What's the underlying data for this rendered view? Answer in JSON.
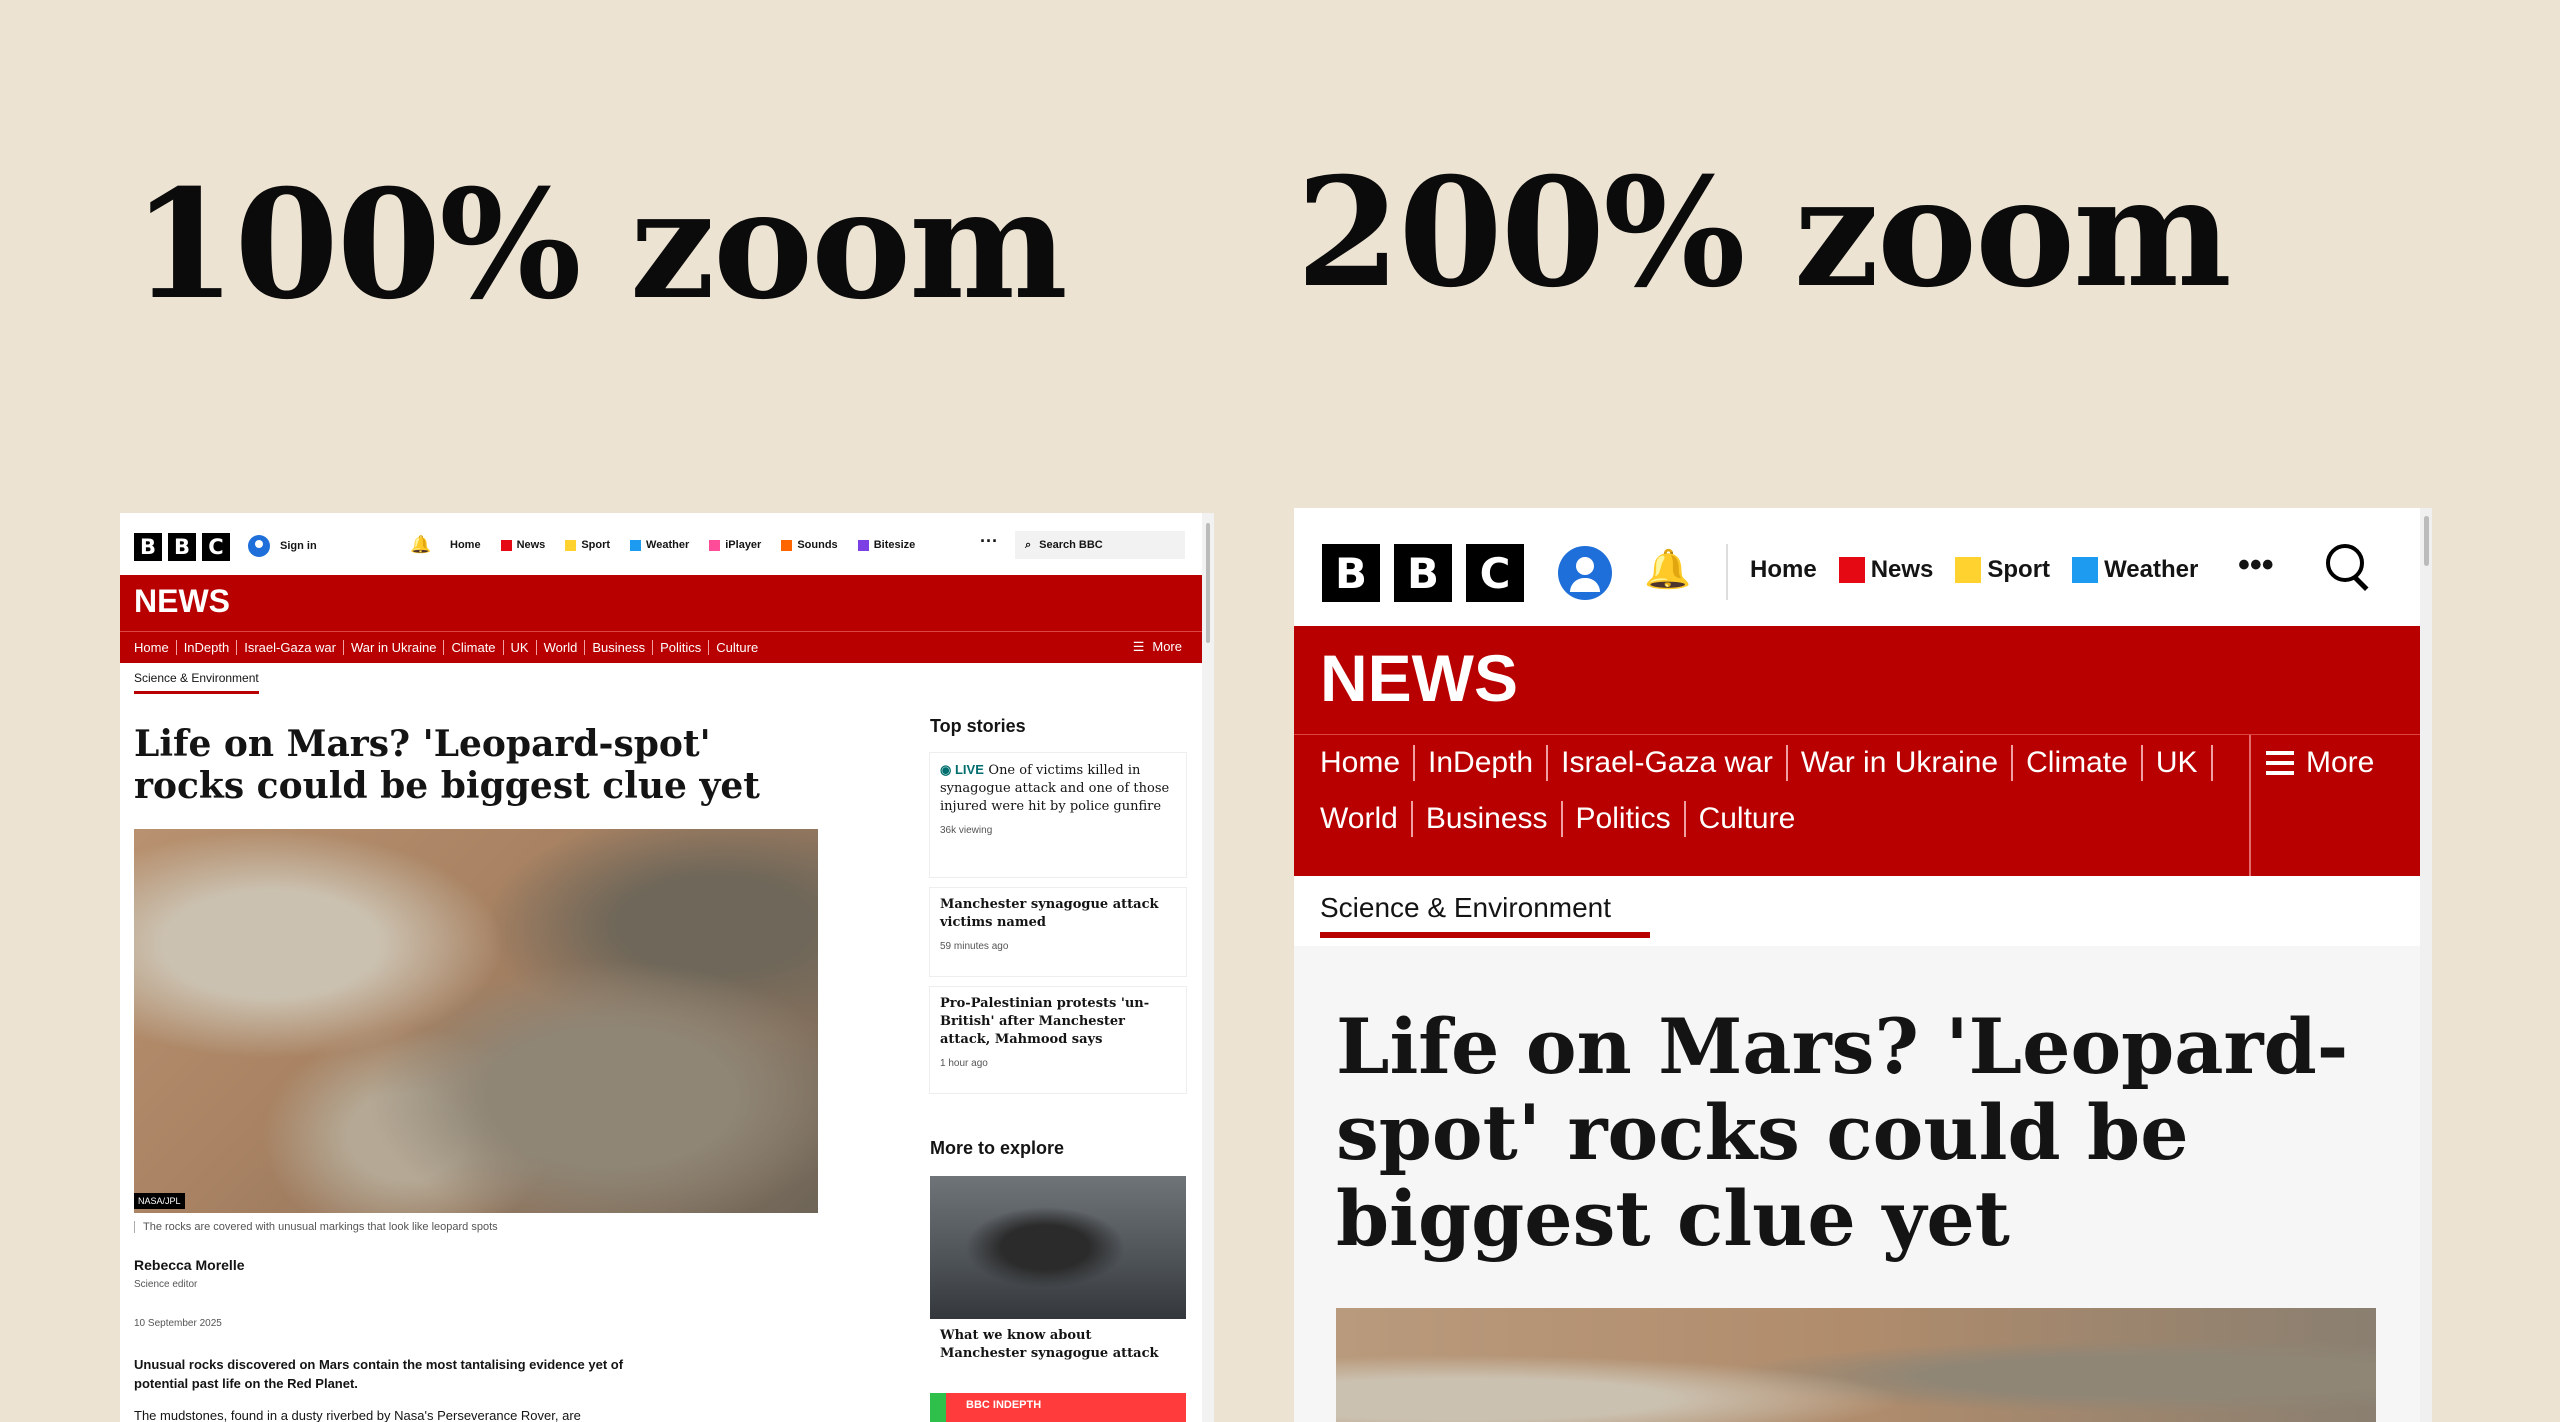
{
  "headings": {
    "left": "100% zoom",
    "right": "200% zoom"
  },
  "colors": {
    "background": "#ede3d3",
    "bbc_red": "#b80000",
    "news_icon": "#e50914",
    "sport_icon": "#ffd230",
    "weather_icon": "#1d9bf0",
    "iplayer_icon": "#ff4c98",
    "sounds_icon": "#ff6600",
    "bitesize_icon": "#7b3fe4"
  },
  "small": {
    "logo": [
      "B",
      "B",
      "C"
    ],
    "signin": "Sign in",
    "nav": [
      "Home",
      "News",
      "Sport",
      "Weather",
      "iPlayer",
      "Sounds",
      "Bitesize"
    ],
    "search_placeholder": "Search BBC",
    "news_label": "NEWS",
    "menu": [
      "Home",
      "InDepth",
      "Israel-Gaza war",
      "War in Ukraine",
      "Climate",
      "UK",
      "World",
      "Business",
      "Politics",
      "Culture"
    ],
    "menu_more": "More",
    "section": "Science & Environment",
    "title": "Life on Mars? 'Leopard-spot' rocks could be biggest clue yet",
    "image_credit": "NASA/JPL",
    "caption": "The rocks are covered with unusual markings that look like leopard spots",
    "author": "Rebecca Morelle",
    "role": "Science editor",
    "date": "10 September 2025",
    "lead": "Unusual rocks discovered on Mars contain the most tantalising evidence yet of potential past life on the Red Planet.",
    "body": "The mudstones, found in a dusty riverbed by Nasa's Perseverance Rover, are",
    "top_stories_heading": "Top stories",
    "top_stories": [
      {
        "live": "LIVE",
        "text": "One of victims killed in synagogue attack and one of those injured were hit by police gunfire",
        "meta": "36k viewing"
      },
      {
        "text": "Manchester synagogue attack victims named",
        "meta": "59 minutes ago"
      },
      {
        "text": "Pro-Palestinian protests 'un-British' after Manchester attack, Mahmood says",
        "meta": "1 hour ago"
      }
    ],
    "explore_heading": "More to explore",
    "explore_caption": "What we know about Manchester synagogue attack",
    "indepth_badge": "BBC INDEPTH"
  },
  "large": {
    "logo": [
      "B",
      "B",
      "C"
    ],
    "nav": [
      "Home",
      "News",
      "Sport",
      "Weather"
    ],
    "more_dots": "•••",
    "news_label": "NEWS",
    "menu": [
      "Home",
      "InDepth",
      "Israel-Gaza war",
      "War in Ukraine",
      "Climate",
      "UK",
      "World",
      "Business",
      "Politics",
      "Culture"
    ],
    "menu_more": "More",
    "section": "Science & Environment",
    "title": "Life on Mars? 'Leopard-spot' rocks could be biggest clue yet"
  }
}
